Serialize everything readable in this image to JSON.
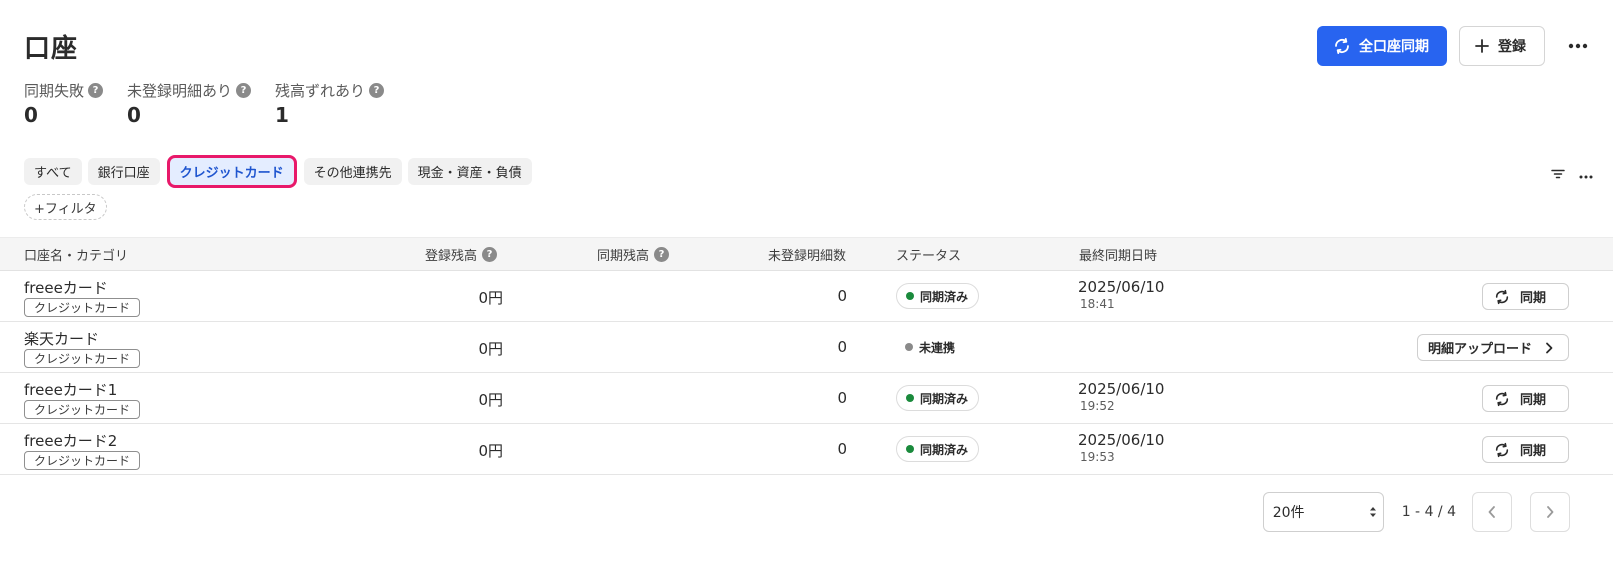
{
  "page": {
    "title": "口座"
  },
  "actions": {
    "sync_all": "全口座同期",
    "register": "登録"
  },
  "summary": [
    {
      "label": "同期失敗",
      "value": "0"
    },
    {
      "label": "未登録明細あり",
      "value": "0"
    },
    {
      "label": "残高ずれあり",
      "value": "1"
    }
  ],
  "tabs": [
    {
      "label": "すべて",
      "active": false
    },
    {
      "label": "銀行口座",
      "active": false
    },
    {
      "label": "クレジットカード",
      "active": true
    },
    {
      "label": "その他連携先",
      "active": false
    },
    {
      "label": "現金・資産・負債",
      "active": false
    }
  ],
  "filter_add": "+フィルタ",
  "table": {
    "headers": {
      "name": "口座名・カテゴリ",
      "registered_balance": "登録残高",
      "synced_balance": "同期残高",
      "unregistered_count": "未登録明細数",
      "status": "ステータス",
      "last_sync": "最終同期日時"
    },
    "rows": [
      {
        "name": "freeeカード",
        "category": "クレジットカード",
        "registered_balance": "0円",
        "synced_balance": "",
        "unregistered_count": "0",
        "status": "同期済み",
        "status_color": "#1a8a3c",
        "date": "2025/06/10",
        "time": "18:41",
        "action": "同期"
      },
      {
        "name": "楽天カード",
        "category": "クレジットカード",
        "registered_balance": "0円",
        "synced_balance": "",
        "unregistered_count": "0",
        "status": "未連携",
        "status_color": "#8a8a8a",
        "date": "",
        "time": "",
        "action": "明細アップロード"
      },
      {
        "name": "freeeカード1",
        "category": "クレジットカード",
        "registered_balance": "0円",
        "synced_balance": "",
        "unregistered_count": "0",
        "status": "同期済み",
        "status_color": "#1a8a3c",
        "date": "2025/06/10",
        "time": "19:52",
        "action": "同期"
      },
      {
        "name": "freeeカード2",
        "category": "クレジットカード",
        "registered_balance": "0円",
        "synced_balance": "",
        "unregistered_count": "0",
        "status": "同期済み",
        "status_color": "#1a8a3c",
        "date": "2025/06/10",
        "time": "19:53",
        "action": "同期"
      }
    ]
  },
  "pagination": {
    "per_page": "20件",
    "range": "1 - 4 / 4"
  },
  "colors": {
    "primary": "#2864f0",
    "highlight": "#e8196a",
    "synced": "#1a8a3c",
    "unlinked": "#8a8a8a"
  },
  "icons": {
    "sync": "sync-icon",
    "plus": "plus-icon",
    "more": "more-horizontal-icon",
    "help": "help-icon",
    "filter": "filter-icon",
    "chevron_right": "chevron-right-icon",
    "chevron_left": "chevron-left-icon",
    "select_arrows": "select-arrows-icon"
  }
}
